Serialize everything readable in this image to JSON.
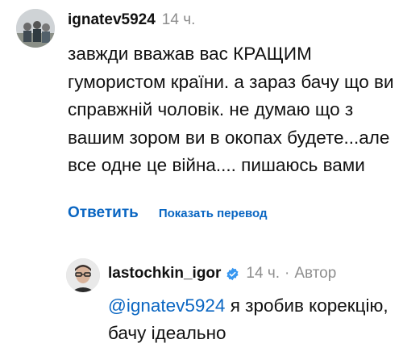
{
  "comment": {
    "username": "ignatev5924",
    "time": "14 ч.",
    "text": "завжди вважав вас КРАЩИМ гумористом країни. а зараз бачу що ви справжній чоловік. не думаю що з вашим зором ви в окопах будете...але все одне це війна.... пишаюсь вами",
    "reply_label": "Ответить",
    "translate_label": "Показать перевод"
  },
  "reply": {
    "username": "lastochkin_igor",
    "verified_icon": "verified-badge-icon",
    "time": "14 ч.",
    "separator": "·",
    "author_label": "Автор",
    "mention": "@ignatev5924",
    "text": " я зробив корекцію, бачу ідеально"
  },
  "colors": {
    "link": "#0a66c2",
    "muted": "#8e8e8e",
    "verified": "#3897f0"
  }
}
